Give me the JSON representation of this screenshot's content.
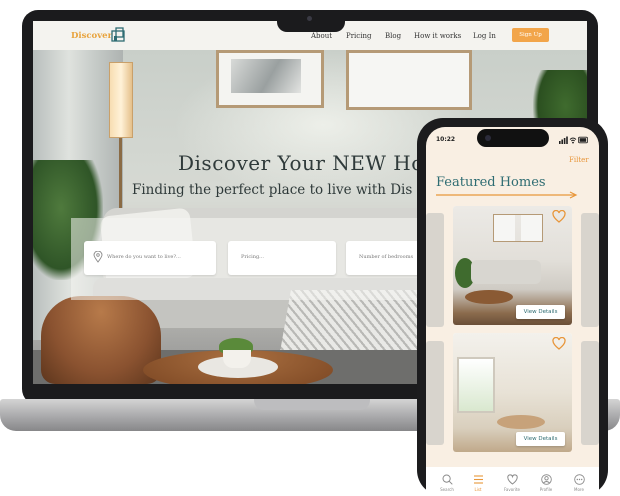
{
  "website": {
    "logo_text": "Discover",
    "nav_links": [
      "About",
      "Pricing",
      "Blog",
      "How it works",
      "Log In"
    ],
    "signup_label": "Sign Up",
    "hero_title": "Discover Your NEW Hor",
    "hero_subtitle": "Finding the perfect place to live with Dis",
    "search_fields": [
      {
        "placeholder": "Where do you want to live?..."
      },
      {
        "placeholder": "Pricing..."
      },
      {
        "placeholder": "Number of bedrooms"
      }
    ]
  },
  "phone": {
    "status_time": "10:22",
    "filter_label": "Filter",
    "section_title": "Featured Homes",
    "cards": [
      {
        "button_label": "View Details"
      },
      {
        "button_label": "View Details"
      }
    ],
    "tabs": [
      {
        "label": "Search",
        "icon": "search-icon",
        "active": false
      },
      {
        "label": "List",
        "icon": "list-icon",
        "active": true
      },
      {
        "label": "Favorite",
        "icon": "heart-icon",
        "active": false
      },
      {
        "label": "Profile",
        "icon": "profile-icon",
        "active": false
      },
      {
        "label": "More",
        "icon": "more-icon",
        "active": false
      }
    ]
  },
  "colors": {
    "accent_orange": "#e8963a",
    "teal": "#2e6c72",
    "phone_background": "#f9efe3"
  }
}
